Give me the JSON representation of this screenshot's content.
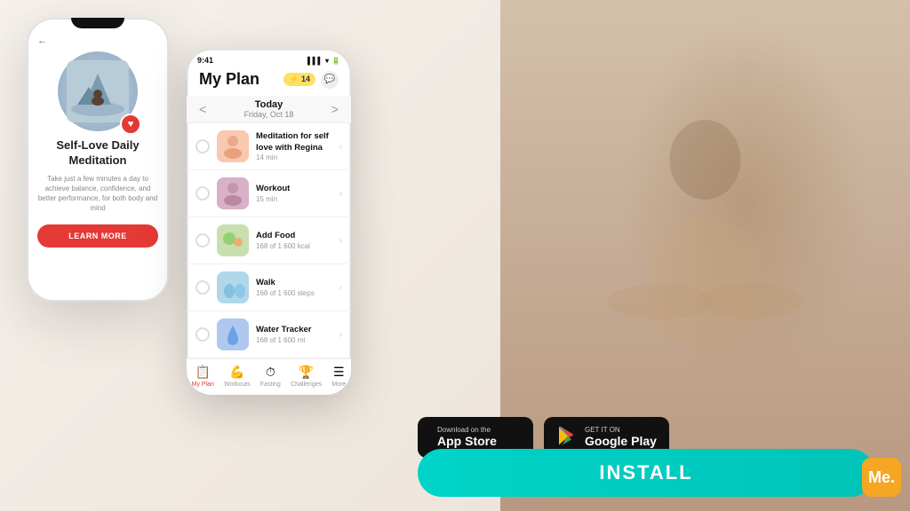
{
  "background": {
    "left_color": "#f5f0eb",
    "right_color": "#c9b9a8"
  },
  "phone_large": {
    "back_label": "←",
    "meditation_title": "Self-Love Daily Meditation",
    "meditation_desc": "Take just a few minutes a day to achieve balance, confidence, and better performance, for both body and mind",
    "learn_more_label": "LEARN MORE"
  },
  "phone_small": {
    "status_time": "9:41",
    "header_title": "My Plan",
    "lightning_count": "⚡ 14",
    "date_label": "Today",
    "date_full": "Friday, Oct 18",
    "activities": [
      {
        "name": "Meditation for self love with Regina",
        "sub": "14 min",
        "thumb_class": "thumb-meditation"
      },
      {
        "name": "Workout",
        "sub": "15 min",
        "thumb_class": "thumb-workout"
      },
      {
        "name": "Add Food",
        "sub": "168 of 1 600 kcal",
        "thumb_class": "thumb-food"
      },
      {
        "name": "Walk",
        "sub": "168 of 1 600 steps",
        "thumb_class": "thumb-walk"
      },
      {
        "name": "Water Tracker",
        "sub": "168 of 1 600 ml",
        "thumb_class": "thumb-water"
      }
    ],
    "nav_items": [
      {
        "label": "My Plan",
        "icon": "📋",
        "active": true
      },
      {
        "label": "Workouts",
        "icon": "💪",
        "active": false
      },
      {
        "label": "Fasting",
        "icon": "⏱",
        "active": false
      },
      {
        "label": "Challenges",
        "icon": "🏆",
        "active": false
      },
      {
        "label": "More",
        "icon": "☰",
        "active": false
      }
    ]
  },
  "app_store": {
    "label_top": "Download on the",
    "label_bottom": "App Store"
  },
  "google_play": {
    "label_top": "GET IT ON",
    "label_bottom": "Google Play"
  },
  "install_button": {
    "label": "INSTALL"
  },
  "me_logo": {
    "label": "Me."
  }
}
